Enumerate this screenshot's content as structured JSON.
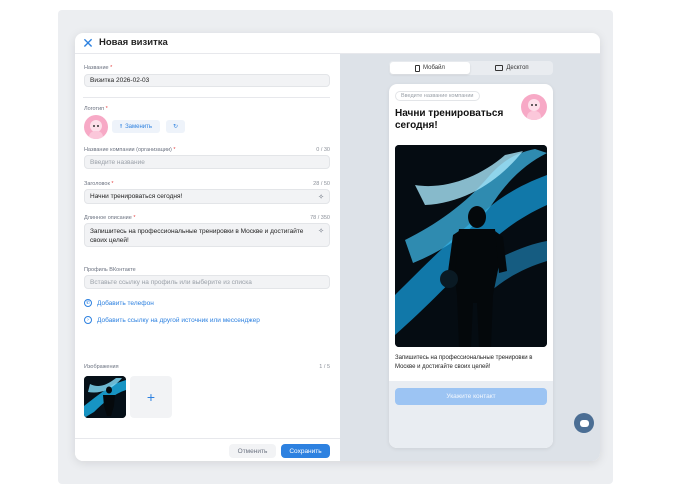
{
  "modal": {
    "title": "Новая визитка",
    "close_label": "✕"
  },
  "form": {
    "name": {
      "label": "Название",
      "required": "*",
      "value": "Визитка 2026-02-03"
    },
    "logo": {
      "label": "Логотип",
      "required": "*",
      "replace_label": "Заменить",
      "replace_icon": "upload-icon",
      "reset_icon": "refresh-icon"
    },
    "company": {
      "label": "Название компании (организации)",
      "required": "*",
      "counter": "0 / 30",
      "placeholder": "Введите название"
    },
    "heading": {
      "label": "Заголовок",
      "required": "*",
      "counter": "28 / 50",
      "value": "Начни тренироваться сегодня!"
    },
    "long_desc": {
      "label": "Длинное описание",
      "required": "*",
      "counter": "78 / 350",
      "value": "Запишитесь на профессиональные тренировки в Москве и достигайте своих целей!"
    },
    "vk_profile": {
      "label": "Профиль ВКонтакте",
      "placeholder": "Вставьте ссылку на профиль или выберите из списка"
    },
    "add_phone": "Добавить телефон",
    "add_link": "Добавить ссылку на другой источник или мессенджер",
    "images": {
      "label": "Изображения",
      "counter": "1 / 5",
      "add_label": "+"
    }
  },
  "footer": {
    "cancel": "Отменить",
    "save": "Сохранить"
  },
  "preview": {
    "tabs": [
      {
        "label": "Мобайл",
        "icon": "phone-icon",
        "active": true
      },
      {
        "label": "Десктоп",
        "icon": "monitor-icon",
        "active": false
      }
    ],
    "company_placeholder": "Введите название компании",
    "title": "Начни тренироваться сегодня!",
    "description": "Запишитесь на профессиональные тренировки в Москве и достигайте своих целей!",
    "contact_button": "Укажите контакт"
  },
  "colors": {
    "accent": "#2d81e0",
    "required": "#e64646",
    "preview_bg": "#dde2e8",
    "contact_disabled": "#9cc4f3"
  }
}
